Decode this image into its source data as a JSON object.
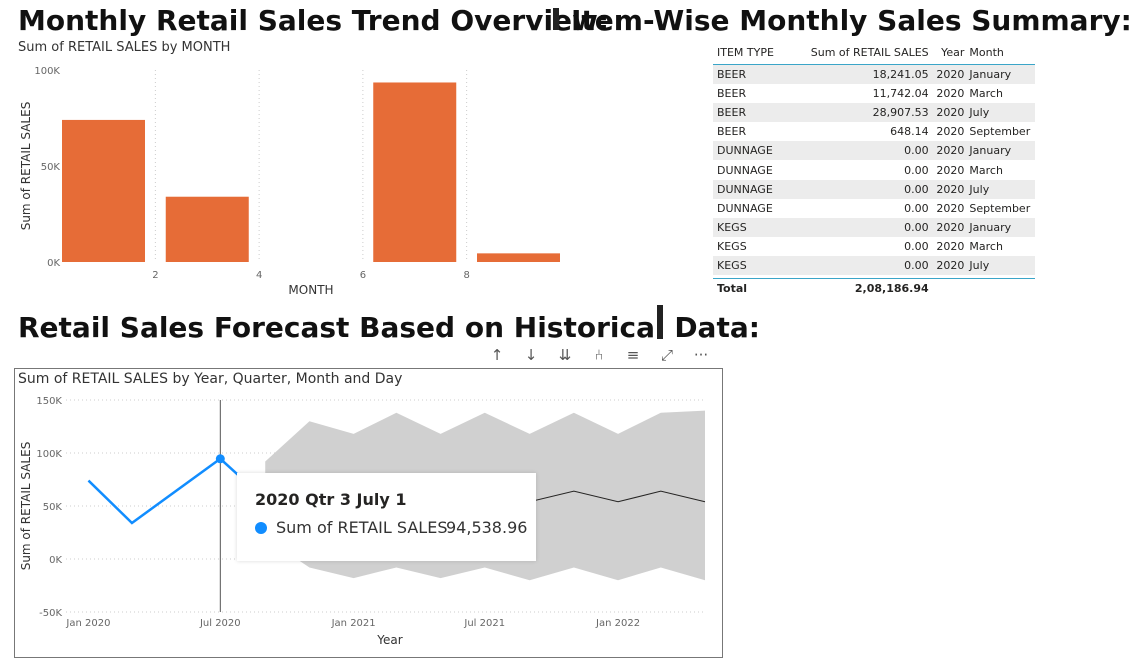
{
  "headings": {
    "trend": "Monthly Retail Sales Trend Overview:",
    "summary": "Item-Wise Monthly Sales Summary:",
    "forecast": "Retail Sales Forecast Based on Historical Data:"
  },
  "colors": {
    "bar": "#e66c37",
    "line": "#118dff",
    "band": "#d0d0d0",
    "forecast": "#252423",
    "table_rule": "#3aa5c8"
  },
  "toolbar": {
    "icons": [
      "arrow-up-icon",
      "arrow-down-icon",
      "double-arrow-down-icon",
      "expand-hierarchy-icon",
      "filter-icon",
      "focus-mode-icon",
      "more-options-icon"
    ],
    "glyphs": [
      "↑",
      "↓",
      "⇊",
      "⑃",
      "≡",
      "⤢",
      "···"
    ]
  },
  "table": {
    "headers": [
      "ITEM TYPE",
      "Sum of RETAIL SALES",
      "Year",
      "Month"
    ],
    "rows": [
      [
        "BEER",
        "18,241.05",
        "2020",
        "January"
      ],
      [
        "BEER",
        "11,742.04",
        "2020",
        "March"
      ],
      [
        "BEER",
        "28,907.53",
        "2020",
        "July"
      ],
      [
        "BEER",
        "648.14",
        "2020",
        "September"
      ],
      [
        "DUNNAGE",
        "0.00",
        "2020",
        "January"
      ],
      [
        "DUNNAGE",
        "0.00",
        "2020",
        "March"
      ],
      [
        "DUNNAGE",
        "0.00",
        "2020",
        "July"
      ],
      [
        "DUNNAGE",
        "0.00",
        "2020",
        "September"
      ],
      [
        "KEGS",
        "0.00",
        "2020",
        "January"
      ],
      [
        "KEGS",
        "0.00",
        "2020",
        "March"
      ],
      [
        "KEGS",
        "0.00",
        "2020",
        "July"
      ],
      [
        "KEGS",
        "0.00",
        "2020",
        "September"
      ]
    ],
    "total_label": "Total",
    "total_value": "2,08,186.94"
  },
  "tooltip": {
    "title": "2020 Qtr 3 July 1",
    "label": "Sum of RETAIL SALES",
    "value": "94,538.96"
  },
  "chart_data": [
    {
      "type": "bar",
      "title": "Sum of RETAIL SALES by MONTH",
      "xlabel": "MONTH",
      "ylabel": "Sum of RETAIL SALES",
      "x": [
        1,
        3,
        7,
        9
      ],
      "values": [
        74000,
        34000,
        93500,
        4500
      ],
      "xticks": [
        2,
        4,
        6,
        8
      ],
      "xlim": [
        0.2,
        9.8
      ],
      "ylim": [
        0,
        100000
      ],
      "yticks": [
        0,
        50000,
        100000
      ],
      "ytick_labels": [
        "0K",
        "50K",
        "100K"
      ],
      "grid": "vertical dotted"
    },
    {
      "type": "line",
      "title": "Sum of RETAIL SALES by Year, Quarter, Month and Day",
      "xlabel": "Year",
      "ylabel": "Sum of RETAIL SALES",
      "ylim": [
        -50000,
        150000
      ],
      "yticks": [
        -50000,
        0,
        50000,
        100000,
        150000
      ],
      "ytick_labels": [
        "-50K",
        "0K",
        "50K",
        "100K",
        "150K"
      ],
      "xticks": [
        "2020-01-01",
        "2020-07-01",
        "2021-01-01",
        "2021-07-01",
        "2022-01-01"
      ],
      "xtick_labels": [
        "Jan 2020",
        "Jul 2020",
        "Jan 2021",
        "Jul 2021",
        "Jan 2022"
      ],
      "xlim": [
        "2019-12-01",
        "2022-05-01"
      ],
      "series": [
        {
          "role": "actual",
          "x": [
            "2020-01-01",
            "2020-03-01",
            "2020-07-01",
            "2020-09-01"
          ],
          "values": [
            74000,
            34000,
            94538.96,
            56000
          ]
        },
        {
          "role": "forecast",
          "x": [
            "2020-09-01",
            "2020-11-01",
            "2021-01-01",
            "2021-03-01",
            "2021-05-01",
            "2021-07-01",
            "2021-09-01",
            "2021-11-01",
            "2022-01-01",
            "2022-03-01",
            "2022-05-01"
          ],
          "values": [
            56000,
            64000,
            54000,
            64000,
            54000,
            64000,
            54000,
            64000,
            54000,
            64000,
            54000
          ],
          "upper": [
            92000,
            130000,
            118000,
            138000,
            118000,
            138000,
            118000,
            138000,
            118000,
            138000,
            140000
          ],
          "lower": [
            20000,
            -8000,
            -18000,
            -8000,
            -18000,
            -8000,
            -20000,
            -8000,
            -20000,
            -8000,
            -20000
          ]
        }
      ],
      "highlight_x": "2020-07-01"
    }
  ]
}
